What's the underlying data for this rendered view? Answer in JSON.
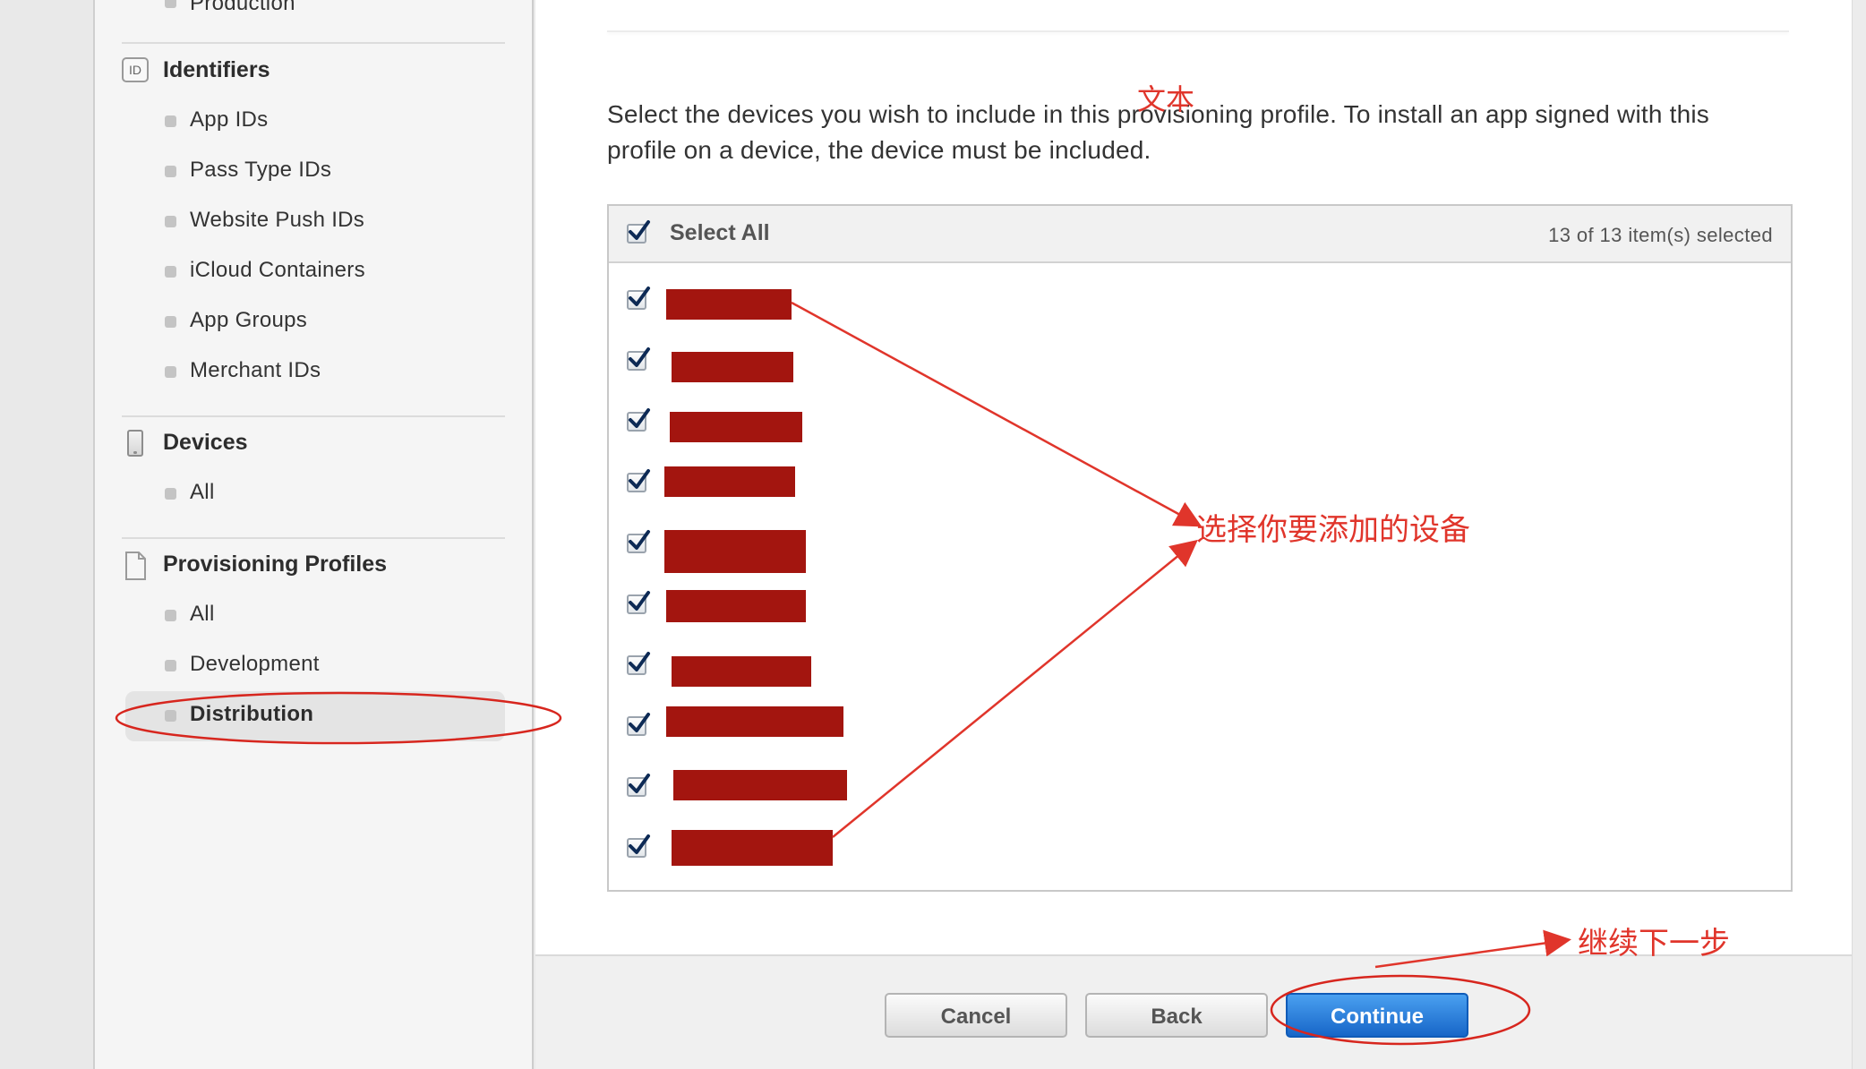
{
  "sidebar": {
    "top_item": "Production",
    "identifiers": {
      "icon_text": "ID",
      "title": "Identifiers",
      "items": [
        "App IDs",
        "Pass Type IDs",
        "Website Push IDs",
        "iCloud Containers",
        "App Groups",
        "Merchant IDs"
      ]
    },
    "devices": {
      "title": "Devices",
      "items": [
        "All"
      ]
    },
    "profiles": {
      "title": "Provisioning Profiles",
      "items": [
        "All",
        "Development",
        "Distribution"
      ],
      "selected": "Distribution"
    }
  },
  "main": {
    "instruction": "Select the devices you wish to include in this provisioning profile. To install an app signed with this profile on a device, the device must be included.",
    "device_list": {
      "select_all_label": "Select All",
      "selected_count": "13 of 13 item(s) selected",
      "visible_rows": 10,
      "all_checked": true
    }
  },
  "footer": {
    "cancel_label": "Cancel",
    "back_label": "Back",
    "continue_label": "Continue"
  },
  "annotations": {
    "top_note": "文本",
    "device_note": "选择你要添加的设备",
    "continue_note": "继续下一步",
    "color": "#e0352b"
  },
  "colors": {
    "redaction": "#a3150f",
    "primary_button": "#1766c8"
  }
}
